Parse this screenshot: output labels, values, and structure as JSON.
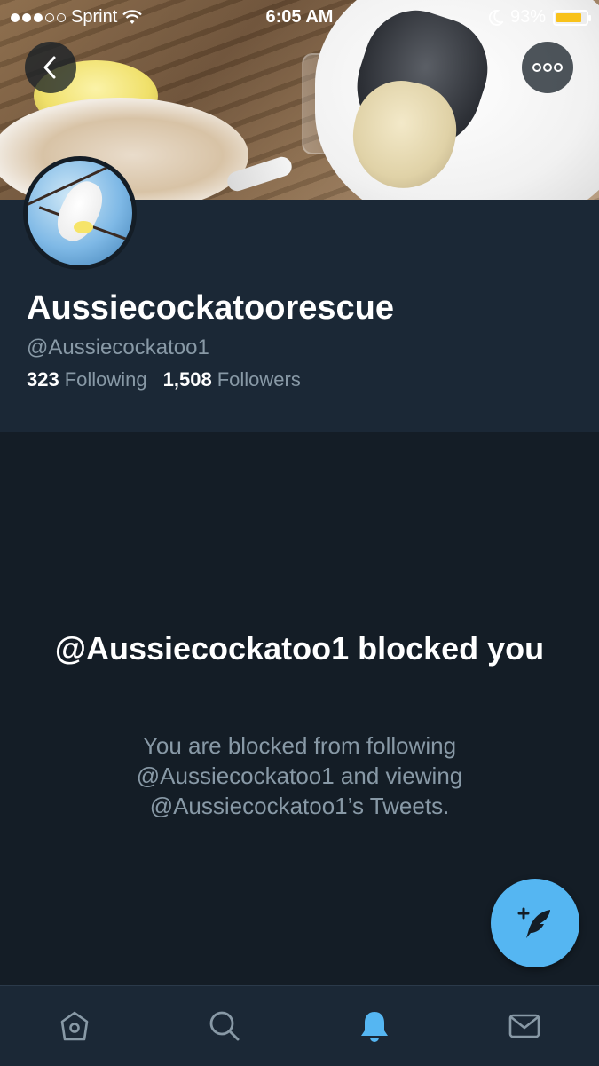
{
  "status_bar": {
    "carrier": "Sprint",
    "time": "6:05 AM",
    "battery": "93%",
    "signal_bars_filled": 3,
    "signal_bars_total": 5
  },
  "header": {
    "back_icon": "chevron-left-icon",
    "more_icon": "more-horizontal-icon"
  },
  "profile": {
    "display_name": "Aussiecockatoorescue",
    "handle": "@Aussiecockatoo1",
    "following_count": "323",
    "following_label": "Following",
    "followers_count": "1,508",
    "followers_label": "Followers"
  },
  "blocked": {
    "title": "@Aussiecockatoo1 blocked you",
    "description": "You are blocked from following @Aussiecockatoo1 and viewing @Aussiecockatoo1’s Tweets."
  },
  "fab": {
    "icon": "compose-tweet-icon"
  },
  "tabs": [
    {
      "name": "home",
      "icon": "home-icon",
      "active": false
    },
    {
      "name": "search",
      "icon": "search-icon",
      "active": false
    },
    {
      "name": "notifications",
      "icon": "bell-icon",
      "active": true
    },
    {
      "name": "messages",
      "icon": "mail-icon",
      "active": false
    }
  ],
  "colors": {
    "background": "#141d26",
    "panel": "#1b2836",
    "secondary_text": "#8899a6",
    "accent": "#55b6f2",
    "battery": "#f8c21b"
  }
}
